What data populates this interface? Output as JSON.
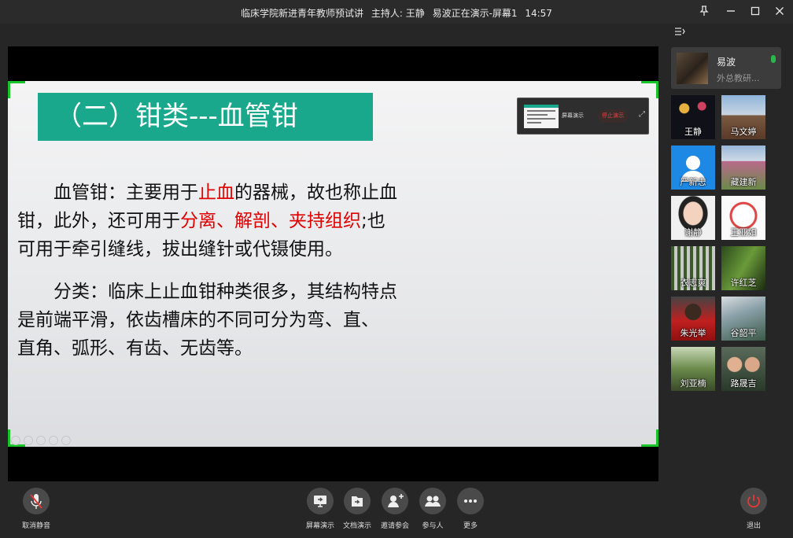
{
  "window": {
    "meeting_title": "临床学院新进青年教师预试讲",
    "host_label": "主持人: 王静",
    "presenting_status": "易波正在演示-屏幕1",
    "clock": "14:57"
  },
  "slide": {
    "title": "（二）钳类---血管钳",
    "paragraph1": {
      "line1_a": "　　血管钳：主要用于",
      "line1_red": "止血",
      "line1_b": "的器械，故也称止血",
      "line2_a": "钳，此外，还可用于",
      "line2_red": "分离、解剖、夹持组织",
      "line2_b": ";也",
      "line3": "可用于牵引缝线，拔出缝针或代镊使用。"
    },
    "paragraph2": {
      "line1": "　　分类：临床上止血钳种类很多，其结构特点",
      "line2": "是前端平滑，依齿槽床的不同可分为弯、直、",
      "line3": "直角、弧形、有齿、无齿等。"
    }
  },
  "preview": {
    "label": "屏幕演示",
    "stop_button": "停止演示"
  },
  "host_card": {
    "name": "易波",
    "org": "外总教研..."
  },
  "participants": [
    {
      "name": "王静"
    },
    {
      "name": "马文婷"
    },
    {
      "name": "严新志"
    },
    {
      "name": "藏建新"
    },
    {
      "name": "谢静"
    },
    {
      "name": "王亚如"
    },
    {
      "name": "衣志爽"
    },
    {
      "name": "许红芝"
    },
    {
      "name": "朱光举"
    },
    {
      "name": "谷韶平"
    },
    {
      "name": "刘亚楠"
    },
    {
      "name": "路晟吉"
    }
  ],
  "toolbar": {
    "unmute": "取消静音",
    "screen_share": "屏幕演示",
    "doc_share": "文档演示",
    "invite": "邀请参会",
    "participants": "参与人",
    "more": "更多",
    "leave": "退出"
  },
  "colors": {
    "slide_title_bg": "#1aa88d",
    "highlight_red": "#e00000",
    "frame_green": "#19c42a",
    "leave_red": "#e53935",
    "mic_green": "#2bb64a"
  }
}
